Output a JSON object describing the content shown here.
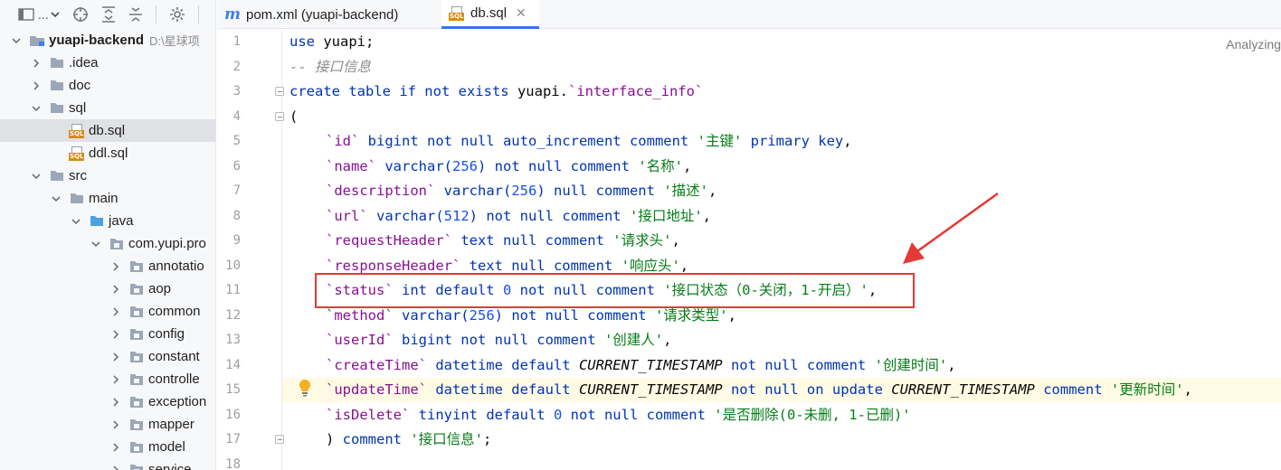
{
  "toolbar": {
    "project_selector_label": "...",
    "icons": [
      "project-view-icon",
      "chevron-down-icon",
      "locate-icon",
      "expand-all-icon",
      "collapse-all-icon",
      "gear-icon"
    ]
  },
  "project_tree": {
    "root": {
      "name": "yuapi-backend",
      "path": "D:\\星球项"
    },
    "items": [
      {
        "label": ".idea",
        "type": "folder",
        "expanded": false
      },
      {
        "label": "doc",
        "type": "folder",
        "expanded": false
      },
      {
        "label": "sql",
        "type": "folder",
        "expanded": true
      },
      {
        "label": "db.sql",
        "type": "sql-file",
        "selected": true
      },
      {
        "label": "ddl.sql",
        "type": "sql-file"
      },
      {
        "label": "src",
        "type": "folder",
        "expanded": true
      },
      {
        "label": "main",
        "type": "folder",
        "expanded": true
      },
      {
        "label": "java",
        "type": "source-folder",
        "expanded": true
      },
      {
        "label": "com.yupi.pro",
        "type": "package",
        "expanded": true
      },
      {
        "label": "annotatio",
        "type": "package",
        "expanded": false
      },
      {
        "label": "aop",
        "type": "package",
        "expanded": false
      },
      {
        "label": "common",
        "type": "package",
        "expanded": false
      },
      {
        "label": "config",
        "type": "package",
        "expanded": false
      },
      {
        "label": "constant",
        "type": "package",
        "expanded": false
      },
      {
        "label": "controlle",
        "type": "package",
        "expanded": false
      },
      {
        "label": "exception",
        "type": "package",
        "expanded": false
      },
      {
        "label": "mapper",
        "type": "package",
        "expanded": false
      },
      {
        "label": "model",
        "type": "package",
        "expanded": false
      },
      {
        "label": "service",
        "type": "package",
        "expanded": false
      }
    ]
  },
  "tabs": [
    {
      "label": "pom.xml (yuapi-backend)",
      "icon": "maven-icon",
      "active": false
    },
    {
      "label": "db.sql",
      "icon": "sql-file-icon",
      "active": true
    }
  ],
  "editor": {
    "status": "Analyzing",
    "line_numbers": [
      "1",
      "2",
      "3",
      "4",
      "5",
      "6",
      "7",
      "8",
      "9",
      "10",
      "11",
      "12",
      "13",
      "14",
      "15",
      "16",
      "17",
      "18"
    ],
    "lines": {
      "l1": {
        "kw": "use",
        "rest": " yuapi;"
      },
      "l2": {
        "comment": "-- 接口信息"
      },
      "l3": {
        "kw": "create table if not exists",
        "rest": " yuapi.",
        "bt": "`interface_info`"
      },
      "l4": {
        "rest": "("
      },
      "l5": {
        "bt": "`id`",
        "kw1": " bigint not null auto_increment comment ",
        "str": "'主键'",
        "kw2": " primary key",
        "tail": ","
      },
      "l6": {
        "bt": "`name`",
        "kw1": " varchar(",
        "num": "256",
        "kw2": ") not null comment ",
        "str": "'名称'",
        "tail": ","
      },
      "l7": {
        "bt": "`description`",
        "kw1": " varchar(",
        "num": "256",
        "kw2": ") null comment ",
        "str": "'描述'",
        "tail": ","
      },
      "l8": {
        "bt": "`url`",
        "kw1": " varchar(",
        "num": "512",
        "kw2": ") not null comment ",
        "str": "'接口地址'",
        "tail": ","
      },
      "l9": {
        "bt": "`requestHeader`",
        "kw1": " text null comment ",
        "str": "'请求头'",
        "tail": ","
      },
      "l10": {
        "bt": "`responseHeader`",
        "kw1": " text null comment ",
        "str": "'响应头'",
        "tail": ","
      },
      "l11": {
        "bt": "`status`",
        "kw1": " int default ",
        "num": "0",
        "kw2": " not null comment ",
        "str": "'接口状态（0-关闭，1-开启）'",
        "tail": ","
      },
      "l12": {
        "bt": "`method`",
        "kw1": " varchar(",
        "num": "256",
        "kw2": ") not null comment ",
        "str": "'请求类型'",
        "tail": ","
      },
      "l13": {
        "bt": "`userId`",
        "kw1": " bigint not null comment ",
        "str": "'创建人'",
        "tail": ","
      },
      "l14": {
        "bt": "`createTime`",
        "kw1": " datetime default ",
        "ital": "CURRENT_TIMESTAMP",
        "kw2": " not null comment ",
        "str": "'创建时间'",
        "tail": ","
      },
      "l15": {
        "bt": "`updateTime`",
        "kw1": " datetime default ",
        "ital": "CURRENT_TIMESTAMP",
        "kw2": " not null on update ",
        "ital2": "CURRENT_TIMESTAMP",
        "kw3": " comment ",
        "str": "'更新时间'",
        "tail": ","
      },
      "l16": {
        "bt": "`isDelete`",
        "kw1": " tinyint default ",
        "num": "0",
        "kw2": " not null comment ",
        "str": "'是否删除(0-未删, 1-已删)'"
      },
      "l17": {
        "rest": ") ",
        "kw": "comment ",
        "str": "'接口信息'",
        "tail": ";"
      }
    }
  },
  "colors": {
    "keyword": "#0033b3",
    "string": "#067d17",
    "comment": "#8c8c8c",
    "number": "#1750eb",
    "backtick_identifier": "#871094",
    "annotation_red": "#e53935",
    "tab_underline": "#3574f0",
    "caret_line": "#fffae3"
  }
}
